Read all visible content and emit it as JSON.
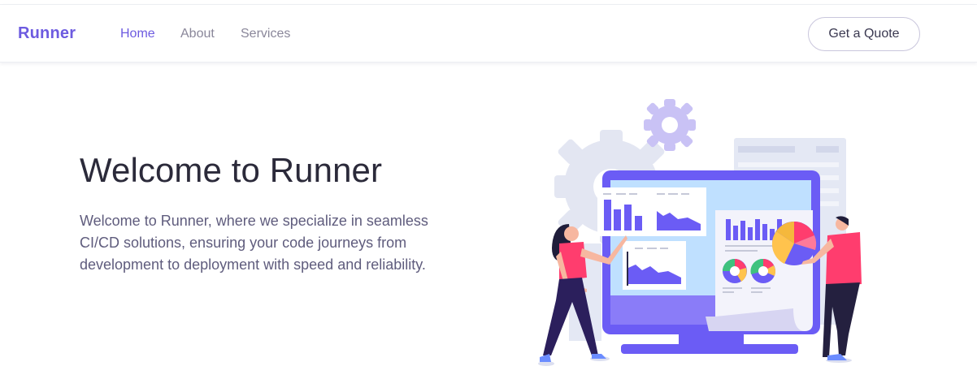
{
  "navbar": {
    "brand": "Runner",
    "links": [
      {
        "label": "Home",
        "active": true
      },
      {
        "label": "About",
        "active": false
      },
      {
        "label": "Services",
        "active": false
      }
    ],
    "cta_label": "Get a Quote"
  },
  "hero": {
    "title": "Welcome to Runner",
    "description": "Welcome to Runner, where we specialize in seamless CI/CD solutions, ensuring your code journeys from development to deployment with speed and reliability."
  },
  "colors": {
    "brand": "#6d5be0",
    "nav_text": "#8a879a",
    "title": "#2b2a3a",
    "body_text": "#5f5c7d",
    "illustration_purple": "#6b5cf5",
    "illustration_pink": "#ff3d6e"
  },
  "illustration": {
    "icon": "dashboard-analytics-illustration"
  }
}
